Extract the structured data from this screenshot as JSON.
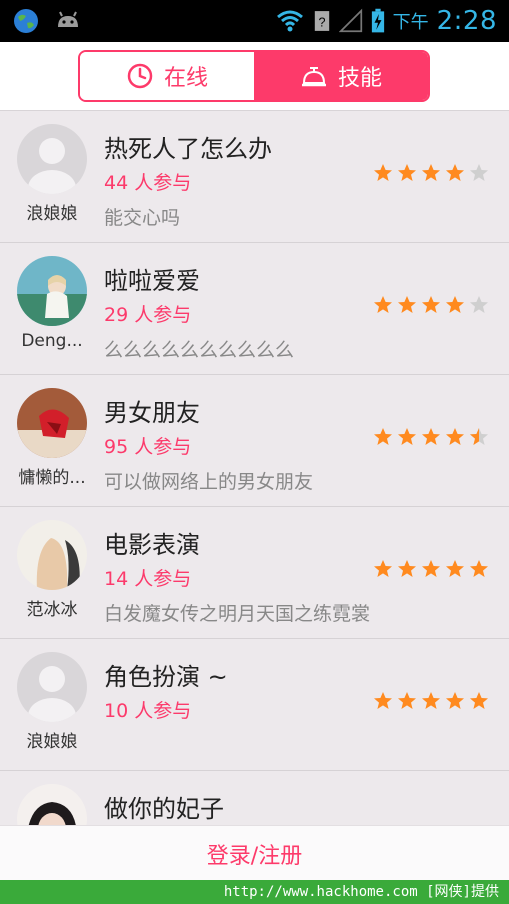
{
  "status_bar": {
    "time_prefix": "下午",
    "time": "2:28"
  },
  "tabs": {
    "online": "在线",
    "skill": "技能"
  },
  "items": [
    {
      "username": "浪娘娘",
      "title": "热死人了怎么办",
      "count": "44 人参与",
      "desc": "能交心吗",
      "rating": 4
    },
    {
      "username": "Deng...",
      "title": "啦啦爱爱",
      "count": "29 人参与",
      "desc": "么么么么么么么么么么",
      "rating": 4
    },
    {
      "username": "慵懒的...",
      "title": "男女朋友",
      "count": "95 人参与",
      "desc": "可以做网络上的男女朋友",
      "rating": 4.5
    },
    {
      "username": "范冰冰",
      "title": "电影表演",
      "count": "14 人参与",
      "desc": "白发魔女传之明月天国之练霓裳",
      "rating": 5
    },
    {
      "username": "浪娘娘",
      "title": "角色扮演 ~",
      "count": "10 人参与",
      "desc": "",
      "rating": 5
    },
    {
      "username": "",
      "title": "做你的妃子",
      "count": "",
      "desc": "",
      "rating": 0
    }
  ],
  "footer": {
    "login_label": "登录/注册"
  },
  "watermark": "http://www.hackhome.com [网侠]提供",
  "colors": {
    "accent": "#fd3a6a",
    "star": "#ff8a1f",
    "star_empty": "#cfcfcf"
  }
}
